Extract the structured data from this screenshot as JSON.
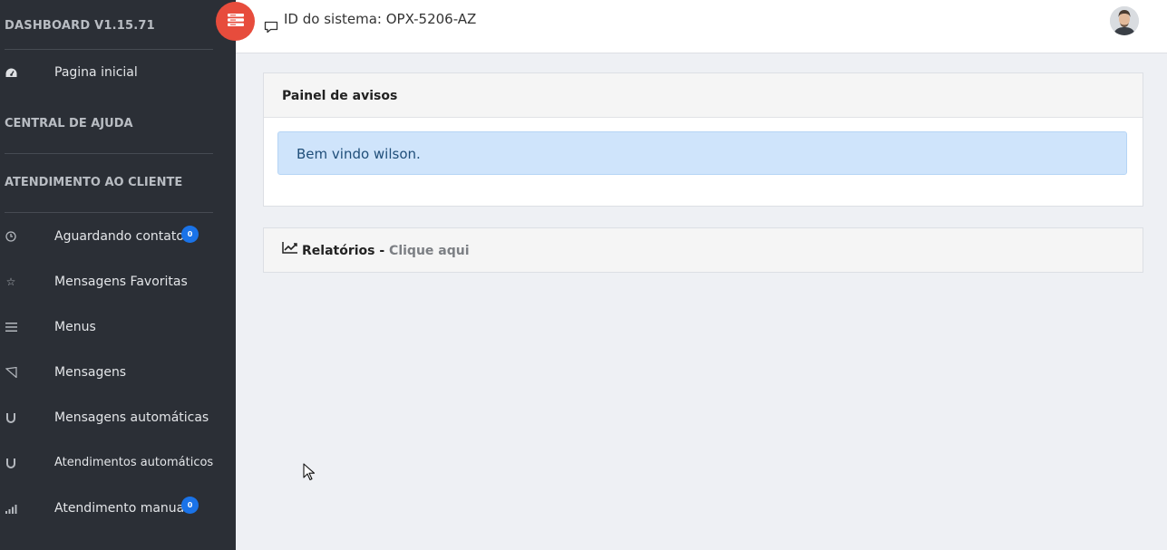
{
  "sidebar": {
    "title": "DASHBOARD V1.15.71",
    "home": {
      "label": "Pagina inicial",
      "icon": "dashboard-icon"
    },
    "help_heading": "CENTRAL DE AJUDA",
    "service_heading": "ATENDIMENTO AO CLIENTE",
    "items": [
      {
        "label": "Aguardando contato",
        "icon": "clock-icon",
        "badge": "0"
      },
      {
        "label": "Mensagens Favoritas",
        "icon": "star-icon"
      },
      {
        "label": "Menus",
        "icon": "menu-lines-icon"
      },
      {
        "label": "Mensagens",
        "icon": "send-icon"
      },
      {
        "label": "Mensagens automáticas",
        "icon": "magnet-icon"
      },
      {
        "label": "Atendimentos automáticos",
        "icon": "magnet-icon"
      },
      {
        "label": "Atendimento manual",
        "icon": "signal-bars-icon",
        "badge": "0"
      }
    ]
  },
  "topbar": {
    "system_id": "ID do sistema: OPX-5206-AZ",
    "toggle_icon": "sidebar-toggle-icon",
    "avatar_icon": "user-avatar"
  },
  "notices_panel": {
    "title": "Painel de avisos",
    "message": "Bem vindo wilson."
  },
  "reports_panel": {
    "title": "Relatórios -",
    "link": "Clique aqui",
    "icon": "line-chart-icon"
  },
  "colors": {
    "sidebar_bg": "#2b2f36",
    "toggle_button": "#e74c3c",
    "badge": "#1a73e8",
    "alert_bg": "#cfe4fb",
    "page_bg": "#eef0f4"
  }
}
